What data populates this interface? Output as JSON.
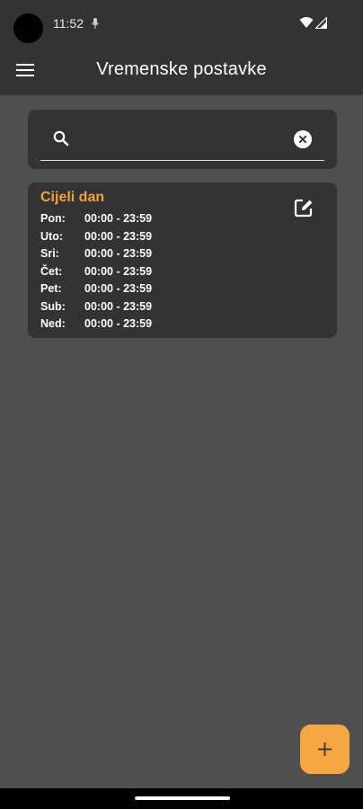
{
  "status_bar": {
    "time": "11:52",
    "icons": [
      "mic-icon",
      "wifi-icon",
      "signal-icon"
    ]
  },
  "app_bar": {
    "title": "Vremenske postavke",
    "menu_icon": "menu-icon"
  },
  "search": {
    "value": "",
    "placeholder": "",
    "search_icon": "search-icon",
    "clear_icon": "clear-icon"
  },
  "schedules": [
    {
      "name": "Cijeli dan",
      "edit_icon": "edit-icon",
      "days": [
        {
          "day": "Pon:",
          "range": "00:00 - 23:59"
        },
        {
          "day": "Uto:",
          "range": "00:00 - 23:59"
        },
        {
          "day": "Sri:",
          "range": "00:00 - 23:59"
        },
        {
          "day": "Čet:",
          "range": "00:00 - 23:59"
        },
        {
          "day": "Pet:",
          "range": "00:00 - 23:59"
        },
        {
          "day": "Sub:",
          "range": "00:00 - 23:59"
        },
        {
          "day": "Ned:",
          "range": "00:00 - 23:59"
        }
      ]
    }
  ],
  "fab": {
    "icon": "plus-icon"
  },
  "colors": {
    "background": "#4f4f4f",
    "surface": "#333333",
    "accent": "#f4a640",
    "title_accent": "#f0a43a"
  }
}
